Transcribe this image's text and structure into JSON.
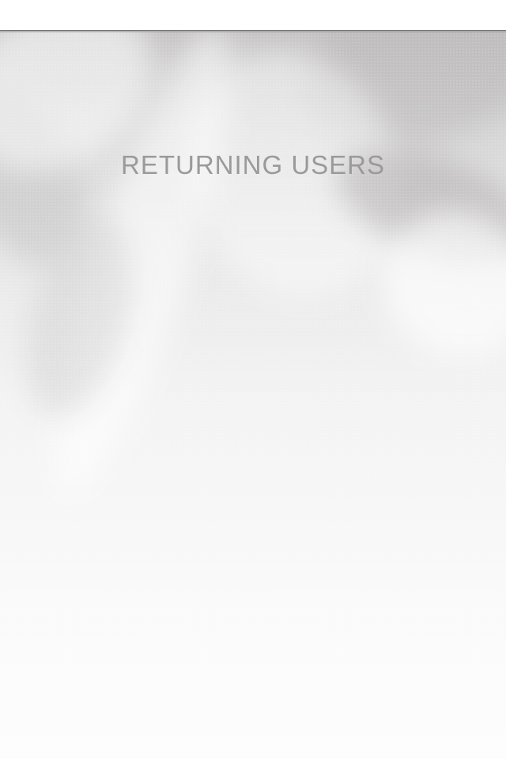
{
  "screen": {
    "title": "RETURNING USERS"
  },
  "colors": {
    "title_text": "#9a9a9a",
    "background_top": "#c4c2c2",
    "background_bottom": "#fdfdfd"
  }
}
